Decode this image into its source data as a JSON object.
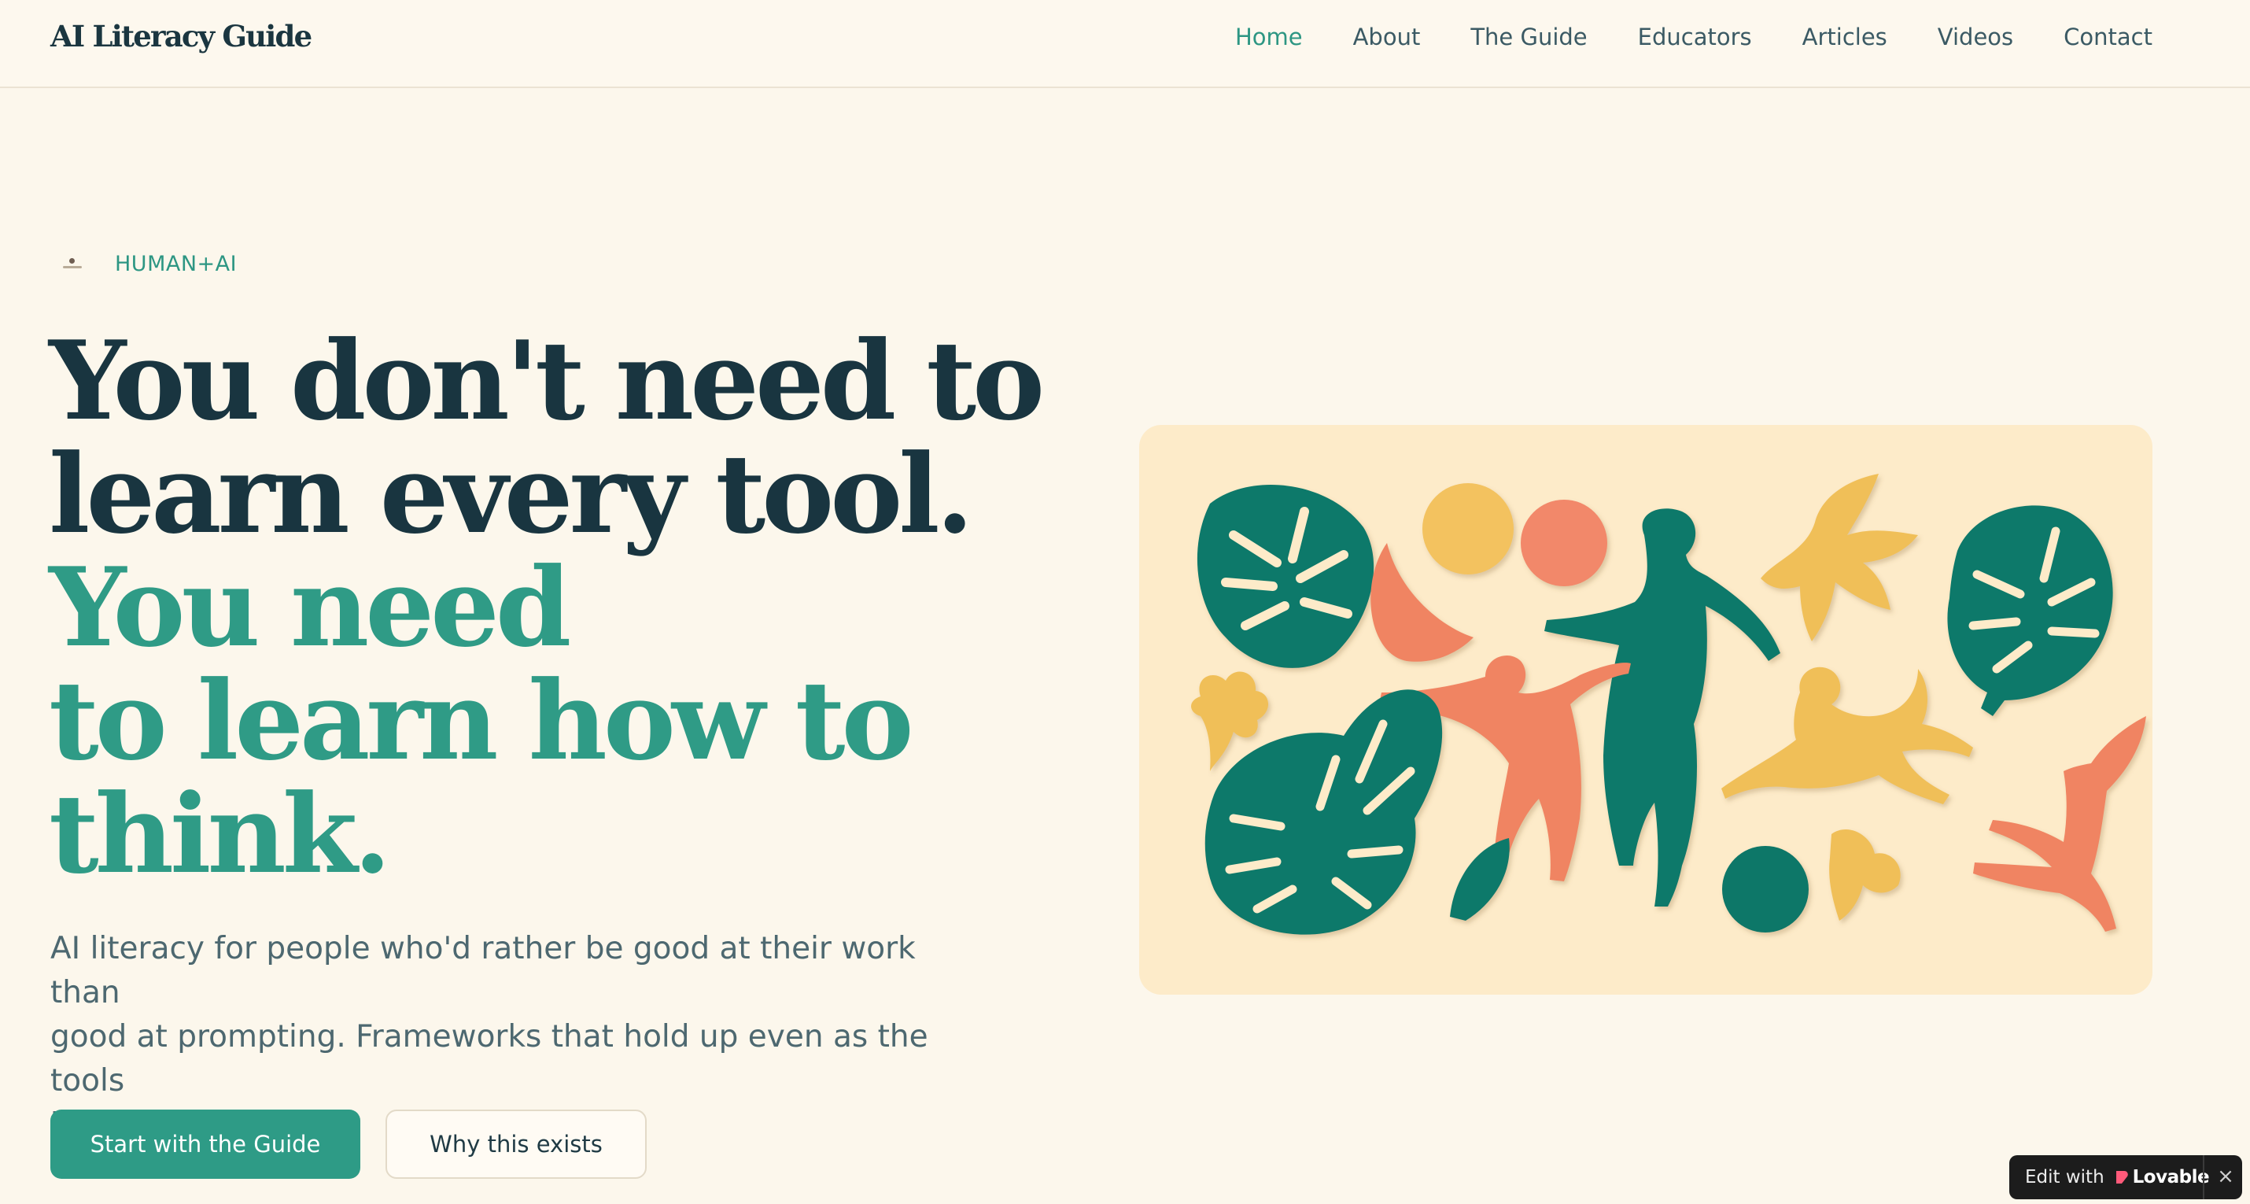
{
  "brand": {
    "logo": "AI Literacy Guide"
  },
  "nav": {
    "items": [
      {
        "label": "Home",
        "active": true
      },
      {
        "label": "About"
      },
      {
        "label": "The Guide"
      },
      {
        "label": "Educators"
      },
      {
        "label": "Articles"
      },
      {
        "label": "Videos"
      },
      {
        "label": "Contact"
      }
    ]
  },
  "hero": {
    "eyebrow": "HUMAN+AI",
    "headline": {
      "line1": "You don't need to",
      "line2": "learn every tool.",
      "line3": "You need",
      "line4": "to learn how to",
      "line5": "think."
    },
    "subhead": "AI literacy for people who'd rather be good at their work than\ngood at prompting. Frameworks that hold up even as the tools\nkeep changing.",
    "primary_cta": "Start with the Guide",
    "secondary_cta": "Why this exists",
    "illustration": "paper-cut collage of people and leaves"
  },
  "badge": {
    "prefix": "Edit with",
    "brand": "Lovable",
    "close": "×"
  },
  "colors": {
    "accent": "#2e9b86",
    "ink": "#193540",
    "background": "#fcf7ec",
    "card": "#fdebc9",
    "coral": "#f08462",
    "mustard": "#f0bf58",
    "deep_teal": "#0f7768"
  }
}
